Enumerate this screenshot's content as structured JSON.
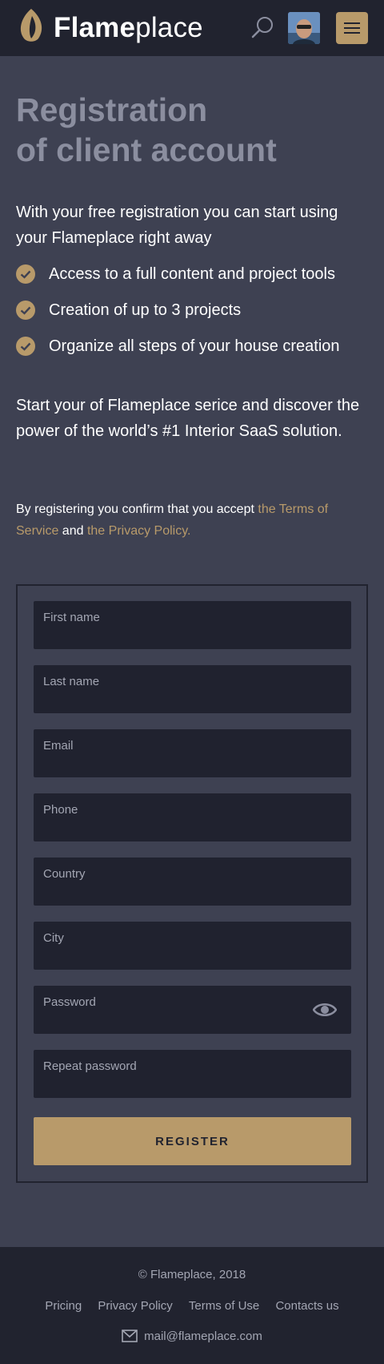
{
  "header": {
    "brand_bold": "Flame",
    "brand_light": "place",
    "icons": [
      "flame-logo-icon",
      "search-icon",
      "avatar",
      "hamburger-menu-icon"
    ]
  },
  "hero": {
    "title_line1": "Registration",
    "title_line2": "of client account",
    "intro": "With your free registration you can start using your Flameplace right away",
    "features": [
      "Access to a full content and project tools",
      "Creation of up to 3 projects",
      "Organize all steps of your house creation"
    ],
    "outro": "Start your of Flameplace serice and discover the power of the world’s #1 Interior SaaS solution.",
    "terms": {
      "prefix": "By registering you confirm that you accept ",
      "terms_link": "the Terms of Service",
      "middle": " and ",
      "privacy_link": "the Privacy Policy."
    }
  },
  "form": {
    "fields": {
      "first_name": "First name",
      "last_name": "Last name",
      "email": "Email",
      "phone": "Phone",
      "country": "Country",
      "city": "City",
      "password": "Password",
      "repeat_password": "Repeat password"
    },
    "submit_label": "REGISTER"
  },
  "footer": {
    "copyright": "© Flameplace, 2018",
    "links": [
      "Pricing",
      "Privacy Policy",
      "Terms of Use",
      "Contacts us"
    ],
    "email": "mail@flameplace.com"
  },
  "colors": {
    "accent": "#b89a6a",
    "background": "#3e4152",
    "header_bg": "#21232f",
    "field_bg": "#20222f",
    "muted_title": "#8b8e9f"
  }
}
